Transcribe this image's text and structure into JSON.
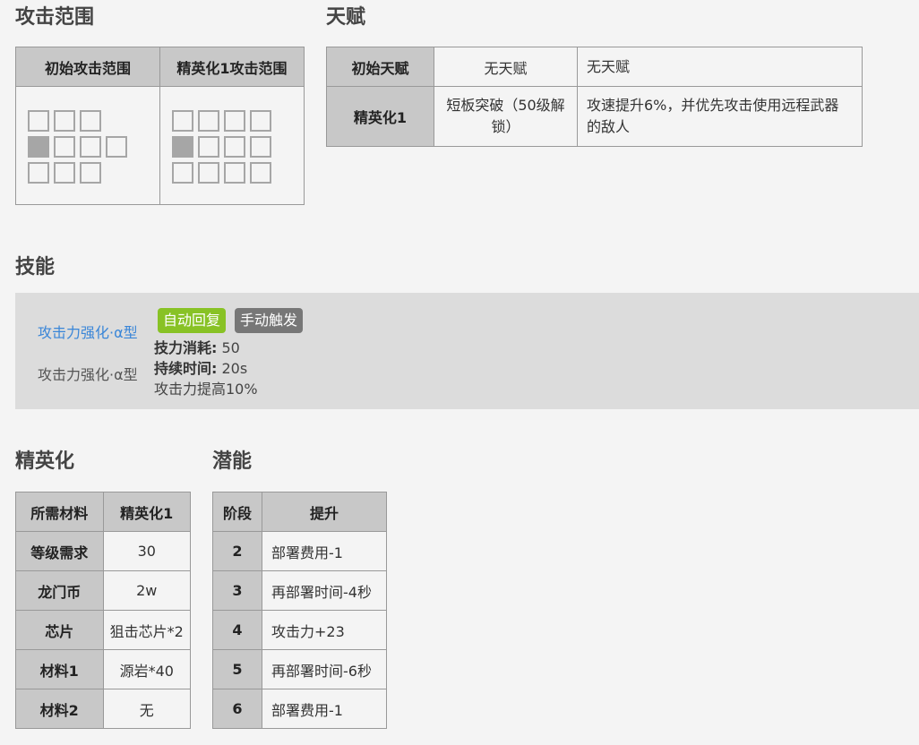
{
  "sections": {
    "range": "攻击范围",
    "talent": "天赋",
    "skill": "技能",
    "elite": "精英化",
    "potential": "潜能"
  },
  "range_table": {
    "headers": [
      "初始攻击范围",
      "精英化1攻击范围"
    ]
  },
  "talent_table": {
    "rows": [
      {
        "stage": "初始天赋",
        "name": "无天赋",
        "desc": "无天赋"
      },
      {
        "stage": "精英化1",
        "name": "短板突破（50级解锁）",
        "desc": "攻速提升6%，并优先攻击使用远程武器的敌人"
      }
    ]
  },
  "skill": {
    "link": "攻击力强化·α型",
    "name": "攻击力强化·α型",
    "tag_recovery": "自动回复",
    "tag_trigger": "手动触发",
    "sp_label": "技力消耗:",
    "sp_value": "50",
    "duration_label": "持续时间:",
    "duration_value": "20s",
    "effect": "攻击力提高10%"
  },
  "elite_table": {
    "header_left": "所需材料",
    "header_right": "精英化1",
    "rows": [
      {
        "label": "等级需求",
        "value": "30"
      },
      {
        "label": "龙门币",
        "value": "2w"
      },
      {
        "label": "芯片",
        "value": "狙击芯片*2"
      },
      {
        "label": "材料1",
        "value": "源岩*40"
      },
      {
        "label": "材料2",
        "value": "无"
      }
    ]
  },
  "potential_table": {
    "header_stage": "阶段",
    "header_boost": "提升",
    "rows": [
      {
        "stage": "2",
        "desc": "部署费用-1"
      },
      {
        "stage": "3",
        "desc": "再部署时间-4秒"
      },
      {
        "stage": "4",
        "desc": "攻击力+23"
      },
      {
        "stage": "5",
        "desc": "再部署时间-6秒"
      },
      {
        "stage": "6",
        "desc": "部署费用-1"
      }
    ]
  },
  "colors": {
    "tag_recovery": "#88c225",
    "tag_trigger": "#777777",
    "link": "#3a86d8"
  }
}
